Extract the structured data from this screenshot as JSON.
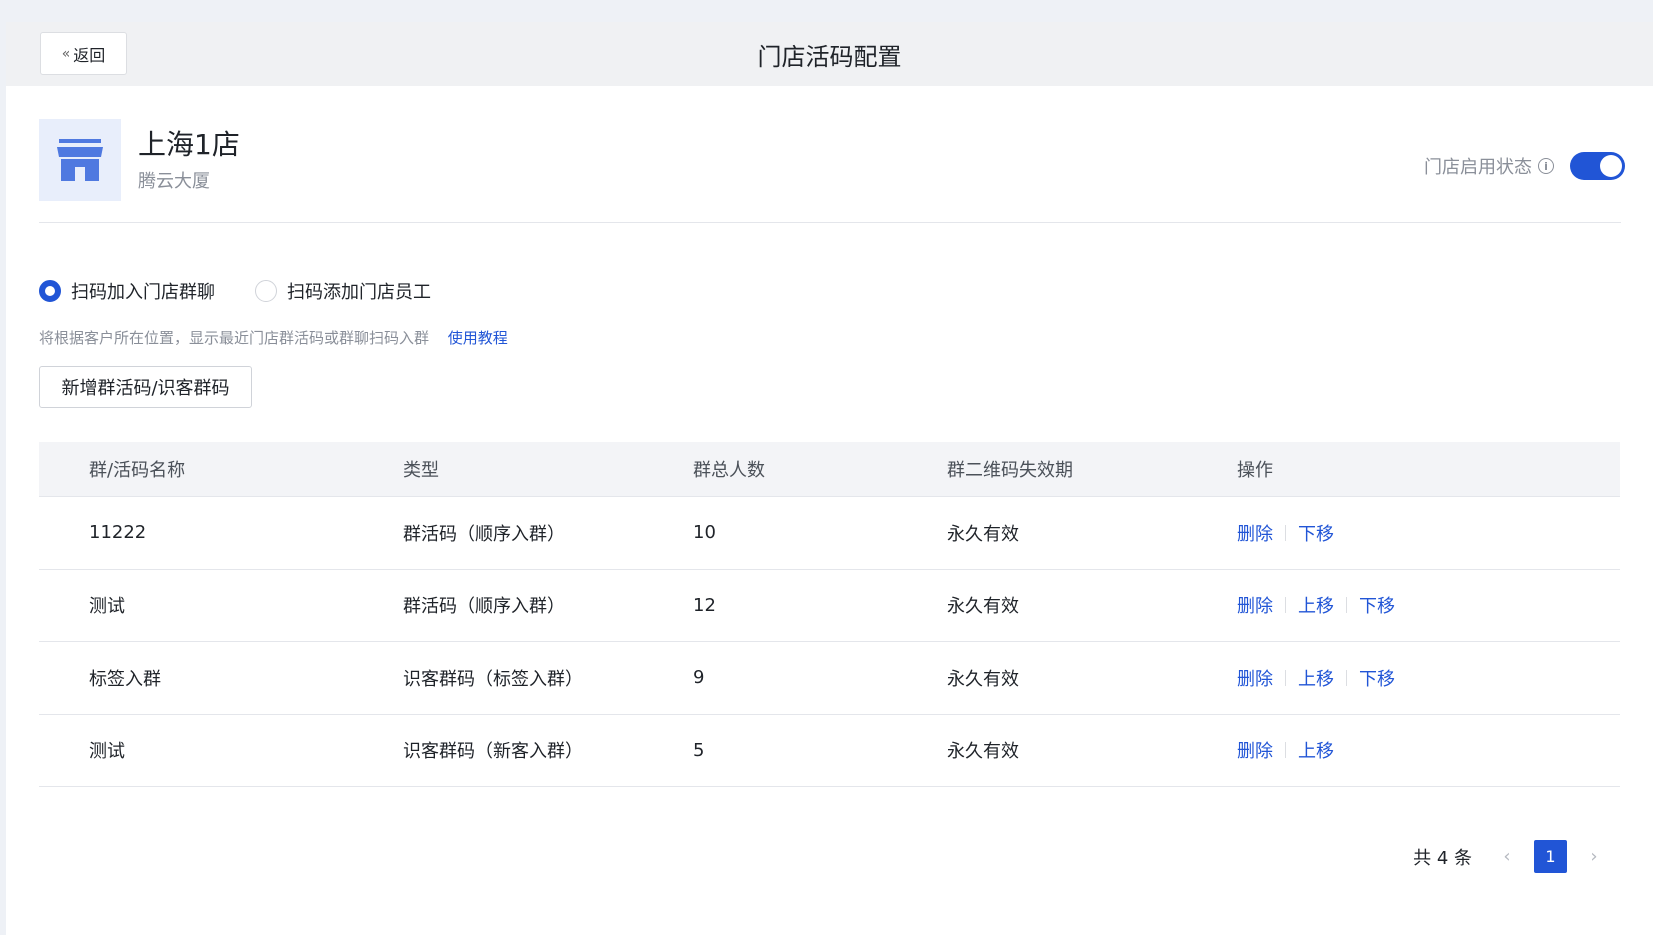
{
  "header": {
    "back_label": "返回",
    "title": "门店活码配置"
  },
  "store": {
    "name": "上海1店",
    "address": "腾云大厦",
    "status_label": "门店启用状态",
    "enabled": true
  },
  "mode": {
    "options": [
      "扫码加入门店群聊",
      "扫码添加门店员工"
    ],
    "selected": 0,
    "hint": "将根据客户所在位置，显示最近门店群活码或群聊扫码入群",
    "tutorial_link": "使用教程"
  },
  "add_button": "新增群活码/识客群码",
  "table": {
    "columns": [
      "群/活码名称",
      "类型",
      "群总人数",
      "群二维码失效期",
      "操作"
    ],
    "rows": [
      {
        "name": "11222",
        "type": "群活码（顺序入群）",
        "count": "10",
        "expiry": "永久有效",
        "ops": [
          "删除",
          "下移"
        ]
      },
      {
        "name": "测试",
        "type": "群活码（顺序入群）",
        "count": "12",
        "expiry": "永久有效",
        "ops": [
          "删除",
          "上移",
          "下移"
        ]
      },
      {
        "name": "标签入群",
        "type": "识客群码（标签入群）",
        "count": "9",
        "expiry": "永久有效",
        "ops": [
          "删除",
          "上移",
          "下移"
        ]
      },
      {
        "name": "测试",
        "type": "识客群码（新客入群）",
        "count": "5",
        "expiry": "永久有效",
        "ops": [
          "删除",
          "上移"
        ]
      }
    ]
  },
  "pagination": {
    "total_text": "共 4 条",
    "current_page": "1"
  },
  "colors": {
    "primary": "#2155d6",
    "muted": "#8a8f99",
    "header_bg": "#f0f1f3"
  }
}
